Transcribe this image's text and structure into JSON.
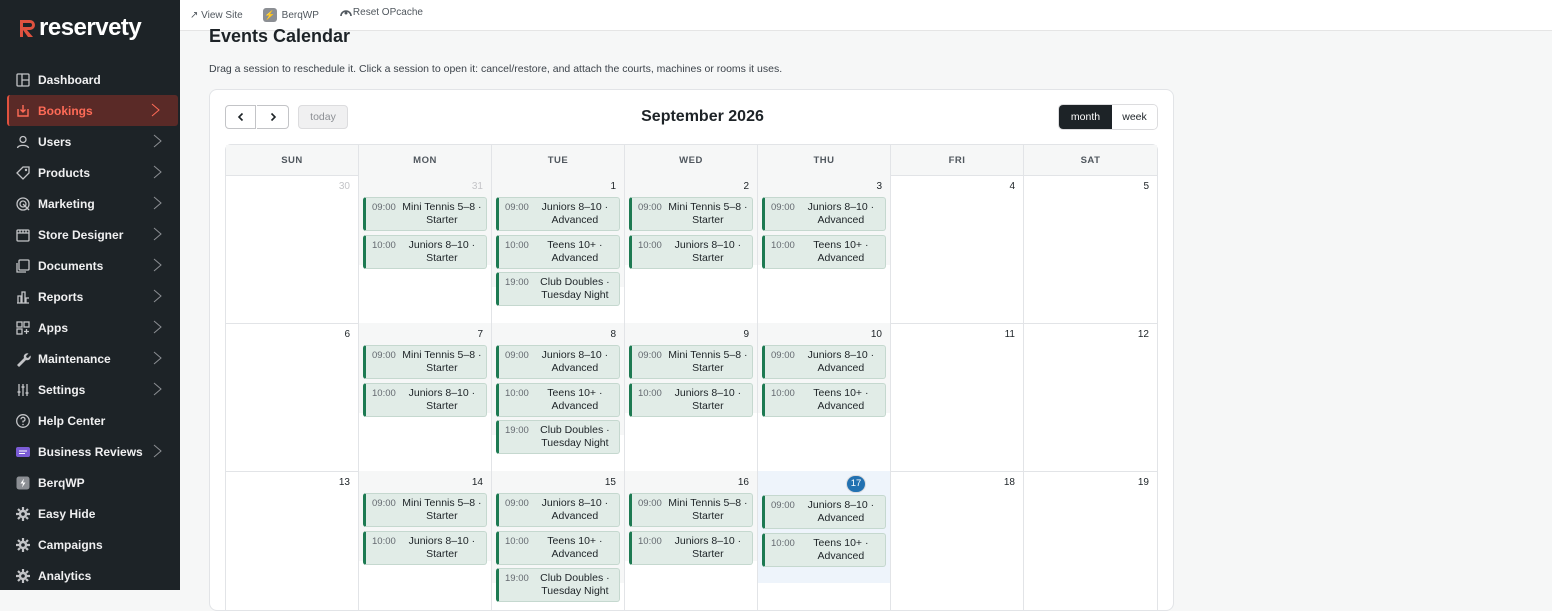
{
  "brand": {
    "name": "reservety",
    "accent": "#e0523f"
  },
  "topbar": {
    "view_site": "↗ View Site",
    "berqwp": "BerqWP",
    "reset_opcache": "Reset OPcache"
  },
  "sidebar": {
    "items": [
      {
        "label": "Dashboard",
        "icon": "dashboard-icon",
        "has_submenu": false
      },
      {
        "label": "Bookings",
        "icon": "bookings-icon",
        "has_submenu": true,
        "active": true
      },
      {
        "label": "Users",
        "icon": "user-icon",
        "has_submenu": true
      },
      {
        "label": "Products",
        "icon": "tag-icon",
        "has_submenu": true
      },
      {
        "label": "Marketing",
        "icon": "marketing-icon",
        "has_submenu": true
      },
      {
        "label": "Store Designer",
        "icon": "store-icon",
        "has_submenu": true
      },
      {
        "label": "Documents",
        "icon": "documents-icon",
        "has_submenu": true
      },
      {
        "label": "Reports",
        "icon": "chart-icon",
        "has_submenu": true
      },
      {
        "label": "Apps",
        "icon": "apps-icon",
        "has_submenu": true
      },
      {
        "label": "Maintenance",
        "icon": "wrench-icon",
        "has_submenu": true
      },
      {
        "label": "Settings",
        "icon": "sliders-icon",
        "has_submenu": true
      },
      {
        "label": "Help Center",
        "icon": "help-icon",
        "has_submenu": false
      },
      {
        "label": "Business Reviews",
        "icon": "reviews-icon",
        "has_submenu": true
      },
      {
        "label": "BerqWP",
        "icon": "berqwp-icon",
        "has_submenu": false
      },
      {
        "label": "Easy Hide",
        "icon": "gear-icon",
        "has_submenu": false
      },
      {
        "label": "Campaigns",
        "icon": "gear-icon",
        "has_submenu": false
      },
      {
        "label": "Analytics",
        "icon": "gear-icon",
        "has_submenu": false
      }
    ]
  },
  "page": {
    "title": "Events Calendar",
    "description": "Drag a session to reschedule it. Click a session to open it: cancel/restore, and attach the courts, machines or rooms it uses."
  },
  "calendar": {
    "month_title": "September 2026",
    "today_label": "today",
    "view_month_label": "month",
    "view_week_label": "week",
    "weekdays": [
      "SUN",
      "MON",
      "TUE",
      "WED",
      "THU",
      "FRI",
      "SAT"
    ],
    "weeks": [
      [
        {
          "day": "30",
          "other": true,
          "events": []
        },
        {
          "day": "31",
          "other": true,
          "tint": true,
          "events": [
            {
              "time": "09:00",
              "name": "Mini Tennis 5–8 · Starter"
            },
            {
              "time": "10:00",
              "name": "Juniors 8–10 · Starter"
            }
          ]
        },
        {
          "day": "1",
          "events": [
            {
              "time": "09:00",
              "name": "Juniors 8–10 · Advanced"
            },
            {
              "time": "10:00",
              "name": "Teens 10+ · Advanced"
            },
            {
              "time": "19:00",
              "name": "Club Doubles · Tuesday Night"
            }
          ]
        },
        {
          "day": "2",
          "events": [
            {
              "time": "09:00",
              "name": "Mini Tennis 5–8 · Starter"
            },
            {
              "time": "10:00",
              "name": "Juniors 8–10 · Starter"
            }
          ]
        },
        {
          "day": "3",
          "events": [
            {
              "time": "09:00",
              "name": "Juniors 8–10 · Advanced"
            },
            {
              "time": "10:00",
              "name": "Teens 10+ · Advanced"
            }
          ]
        },
        {
          "day": "4",
          "events": []
        },
        {
          "day": "5",
          "events": []
        }
      ],
      [
        {
          "day": "6",
          "events": []
        },
        {
          "day": "7",
          "events": [
            {
              "time": "09:00",
              "name": "Mini Tennis 5–8 · Starter"
            },
            {
              "time": "10:00",
              "name": "Juniors 8–10 · Starter"
            }
          ]
        },
        {
          "day": "8",
          "events": [
            {
              "time": "09:00",
              "name": "Juniors 8–10 · Advanced"
            },
            {
              "time": "10:00",
              "name": "Teens 10+ · Advanced"
            },
            {
              "time": "19:00",
              "name": "Club Doubles · Tuesday Night"
            }
          ]
        },
        {
          "day": "9",
          "events": [
            {
              "time": "09:00",
              "name": "Mini Tennis 5–8 · Starter"
            },
            {
              "time": "10:00",
              "name": "Juniors 8–10 · Starter"
            }
          ]
        },
        {
          "day": "10",
          "events": [
            {
              "time": "09:00",
              "name": "Juniors 8–10 · Advanced"
            },
            {
              "time": "10:00",
              "name": "Teens 10+ · Advanced"
            }
          ]
        },
        {
          "day": "11",
          "events": []
        },
        {
          "day": "12",
          "events": []
        }
      ],
      [
        {
          "day": "13",
          "events": []
        },
        {
          "day": "14",
          "events": [
            {
              "time": "09:00",
              "name": "Mini Tennis 5–8 · Starter"
            },
            {
              "time": "10:00",
              "name": "Juniors 8–10 · Starter"
            }
          ]
        },
        {
          "day": "15",
          "events": [
            {
              "time": "09:00",
              "name": "Juniors 8–10 · Advanced"
            },
            {
              "time": "10:00",
              "name": "Teens 10+ · Advanced"
            },
            {
              "time": "19:00",
              "name": "Club Doubles · Tuesday Night"
            }
          ]
        },
        {
          "day": "16",
          "events": [
            {
              "time": "09:00",
              "name": "Mini Tennis 5–8 · Starter"
            },
            {
              "time": "10:00",
              "name": "Juniors 8–10 · Starter"
            }
          ]
        },
        {
          "day": "17",
          "today": true,
          "events": [
            {
              "time": "09:00",
              "name": "Juniors 8–10 · Advanced"
            },
            {
              "time": "10:00",
              "name": "Teens 10+ · Advanced"
            }
          ]
        },
        {
          "day": "18",
          "events": []
        },
        {
          "day": "19",
          "events": []
        }
      ]
    ]
  }
}
